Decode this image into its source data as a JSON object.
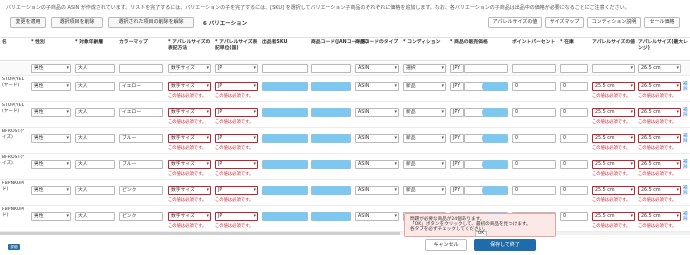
{
  "notice": "バリエーションの子商品の ASIN が作成されています。リストを完了するには、バリエーションの子を完了するには、[SKU] を選択してバリエーション子商品のそれぞれに価格を追加します。なお、各バリエーションの子商品は出品中の価格が必要になることにご注意ください。",
  "toolbar": {
    "apply_changes": "変更を適用",
    "deselect": "選択項目を削除",
    "bulk_delete": "選択された項目の削除を解除",
    "variation_count": "6 バリエーション"
  },
  "tabs": [
    "アパレルサイズの値",
    "サイズマップ",
    "コンディション説明",
    "セール価格"
  ],
  "headers": {
    "name": "名",
    "gender": "* 性別",
    "target_age": "* 対象年齢層",
    "color_map": "カラーマップ",
    "size_system": "* アパレルサイズの表記方法",
    "size_region": "* アパレルサイズ表記単位(国)",
    "sku": "出品者SKU",
    "product_code": "商品コード(JANコード等)",
    "code_type": "商品コードのタイプ",
    "condition": "* コンディション",
    "price": "* 商品の販売価格",
    "points": "ポイントパーセント",
    "stock": "* 在庫",
    "apparel_size": "アパレルサイズの値",
    "apparel_size_max": "アパレルサイズ(最大レンジ)"
  },
  "filter_row": {
    "gender": "男性",
    "age": "大人",
    "size_system": "数字サイズ",
    "region": "JP",
    "code_type": "ASIN",
    "condition": "選択",
    "currency": "JPY",
    "size_max": "26.5 cm"
  },
  "rows": [
    {
      "name": "STOP(YEL)(ヤード)",
      "gender": "男性",
      "age": "大人",
      "color": "イエロー",
      "size_system": "数字サイズ",
      "region": "JP",
      "code_type": "ASIN",
      "condition": "新品",
      "currency": "JPY",
      "points": "0",
      "stock": "0",
      "size": "25.5 cm",
      "size_max": "26.5 cm",
      "link": "補\n除"
    },
    {
      "name": "STOP(YEL)(ヤード)",
      "gender": "男性",
      "age": "大人",
      "color": "イエロー",
      "size_system": "数字サイズ",
      "region": "JP",
      "code_type": "ASIN",
      "condition": "新品",
      "currency": "JPY",
      "points": "0",
      "stock": "0",
      "size": "25.5 cm",
      "size_max": "26.5 cm",
      "link": "補\n除"
    },
    {
      "name": "BFROST(ウ イズ)",
      "gender": "男性",
      "age": "大人",
      "color": "ブルー",
      "size_system": "数字サイズ",
      "region": "JP",
      "code_type": "ASIN",
      "condition": "新品",
      "currency": "JPY",
      "points": "0",
      "stock": "0",
      "size": "25.5 cm",
      "size_max": "26.5 cm",
      "link": "補\n除"
    },
    {
      "name": "BFROST(ウ イズ)",
      "gender": "男性",
      "age": "大人",
      "color": "ブルー",
      "size_system": "数字サイズ",
      "region": "JP",
      "code_type": "ASIN",
      "condition": "新品",
      "currency": "JPY",
      "points": "0",
      "stock": "0",
      "size": "25.5 cm",
      "size_max": "26.5 cm",
      "link": "補\n除"
    },
    {
      "name": "FBPNKUP(ピ ド)",
      "gender": "男性",
      "age": "大人",
      "color": "ピンク",
      "size_system": "数字サイズ",
      "region": "JP",
      "code_type": "ASIN",
      "condition": "新品",
      "currency": "JPY",
      "points": "0",
      "stock": "0",
      "size": "25.5 cm",
      "size_max": "26.5 cm",
      "link": "補\n除"
    },
    {
      "name": "FBPNKUP(ピ ド)",
      "gender": "男性",
      "age": "大人",
      "color": "ピンク",
      "size_system": "数字サイズ",
      "region": "JP",
      "code_type": "ASIN",
      "condition": "新品",
      "currency": "JPY",
      "points": "0",
      "stock": "0",
      "size": "25.5 cm",
      "size_max": "26.5 cm",
      "link": "補\n除"
    }
  ],
  "required_error": "この値は必須です。",
  "popup": {
    "line1": "問題が必要な商品が24個あります。",
    "line2": "「OK」ボタンをクリックして、最初の商品を見つけます。",
    "line3": "各タブを必ずチェックしてください。",
    "ok": "OK"
  },
  "footer": {
    "cancel": "キャンセル",
    "save": "保存して終了"
  },
  "corner_tag": "詳細"
}
